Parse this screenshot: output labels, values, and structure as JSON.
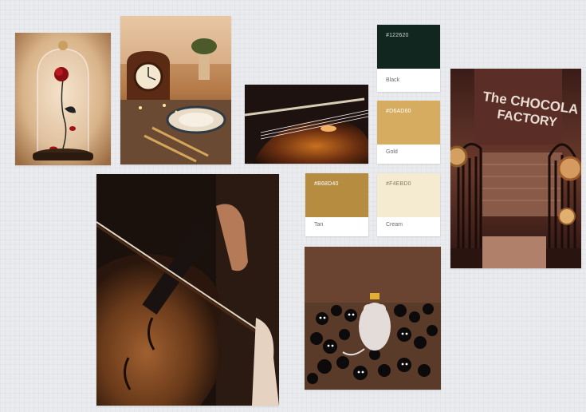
{
  "board": {
    "photos": [
      {
        "id": "rose-dome",
        "icon": "rose-under-glass-icon"
      },
      {
        "id": "clock-table",
        "icon": "clock-table-setting-icon"
      },
      {
        "id": "violin-small",
        "icon": "violin-strings-icon"
      },
      {
        "id": "violin-large",
        "icon": "violin-player-icon"
      },
      {
        "id": "chocolate-factory",
        "icon": "factory-gate-icon",
        "sign_line1": "The CHOCOLA",
        "sign_line2": "FACTORY"
      },
      {
        "id": "soot-sprites",
        "icon": "mouse-soot-sprites-icon"
      }
    ],
    "swatches": [
      {
        "hex": "#122620",
        "name": "Black",
        "color": "#122620",
        "text_color": "#cfd6d2"
      },
      {
        "hex": "#D6AD60",
        "name": "Gold",
        "color": "#D6AD60",
        "text_color": "#ffffff"
      },
      {
        "hex": "#B68D40",
        "name": "Tan",
        "color": "#B68D40",
        "text_color": "#ffffff"
      },
      {
        "hex": "#F4EBD0",
        "name": "Cream",
        "color": "#F4EBD0",
        "text_color": "#8a7d60"
      }
    ]
  }
}
